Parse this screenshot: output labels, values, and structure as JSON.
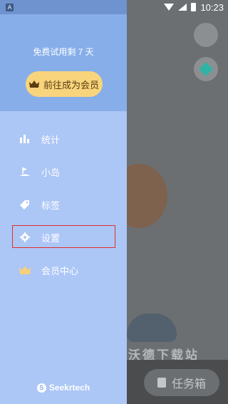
{
  "status_bar": {
    "time": "10:23",
    "app_icon": "A"
  },
  "drawer": {
    "trial_text": "免费试用剩 7 天",
    "vip_button_label": "前往成为会员",
    "menu": [
      {
        "label": "统计",
        "icon": "bar-chart-icon"
      },
      {
        "label": "小岛",
        "icon": "island-flag-icon"
      },
      {
        "label": "标签",
        "icon": "tag-icon"
      },
      {
        "label": "设置",
        "icon": "gear-icon"
      },
      {
        "label": "会员中心",
        "icon": "crown-icon"
      }
    ],
    "brand": "Seekrtech"
  },
  "background": {
    "task_button_label": "任务箱",
    "watermark": "沃德下载站"
  },
  "colors": {
    "drawer_bg": "#acc6f6",
    "drawer_header": "#87aee9",
    "vip_button": "#f8d47c",
    "highlight": "#e0312b"
  }
}
